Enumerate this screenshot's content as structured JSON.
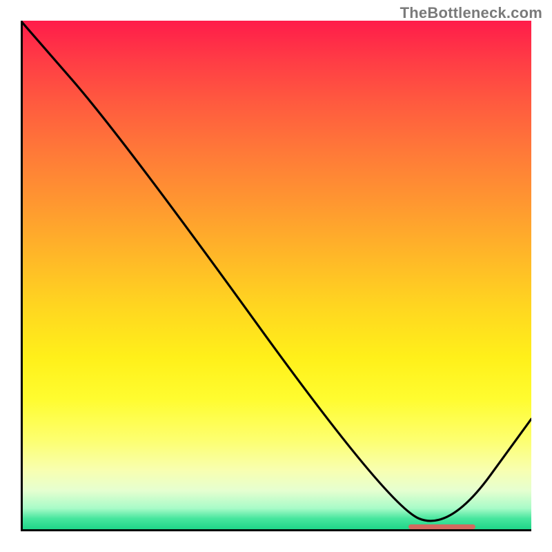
{
  "watermark": "TheBottleneck.com",
  "chart_data": {
    "type": "line",
    "title": "",
    "xlabel": "",
    "ylabel": "",
    "xlim": [
      0,
      100
    ],
    "ylim": [
      0,
      100
    ],
    "grid": false,
    "series": [
      {
        "name": "curve",
        "x": [
          0,
          20,
          72,
          84,
          100
        ],
        "values": [
          100,
          77,
          5,
          0,
          22
        ]
      }
    ],
    "gradient_stops": [
      {
        "pct": 0,
        "color": "#ff1c4a"
      },
      {
        "pct": 50,
        "color": "#ffd620"
      },
      {
        "pct": 85,
        "color": "#fdff6e"
      },
      {
        "pct": 100,
        "color": "#17d284"
      }
    ],
    "marker": {
      "x_start": 76,
      "x_end": 89,
      "y": 0.5,
      "color": "#d26a5f"
    }
  }
}
